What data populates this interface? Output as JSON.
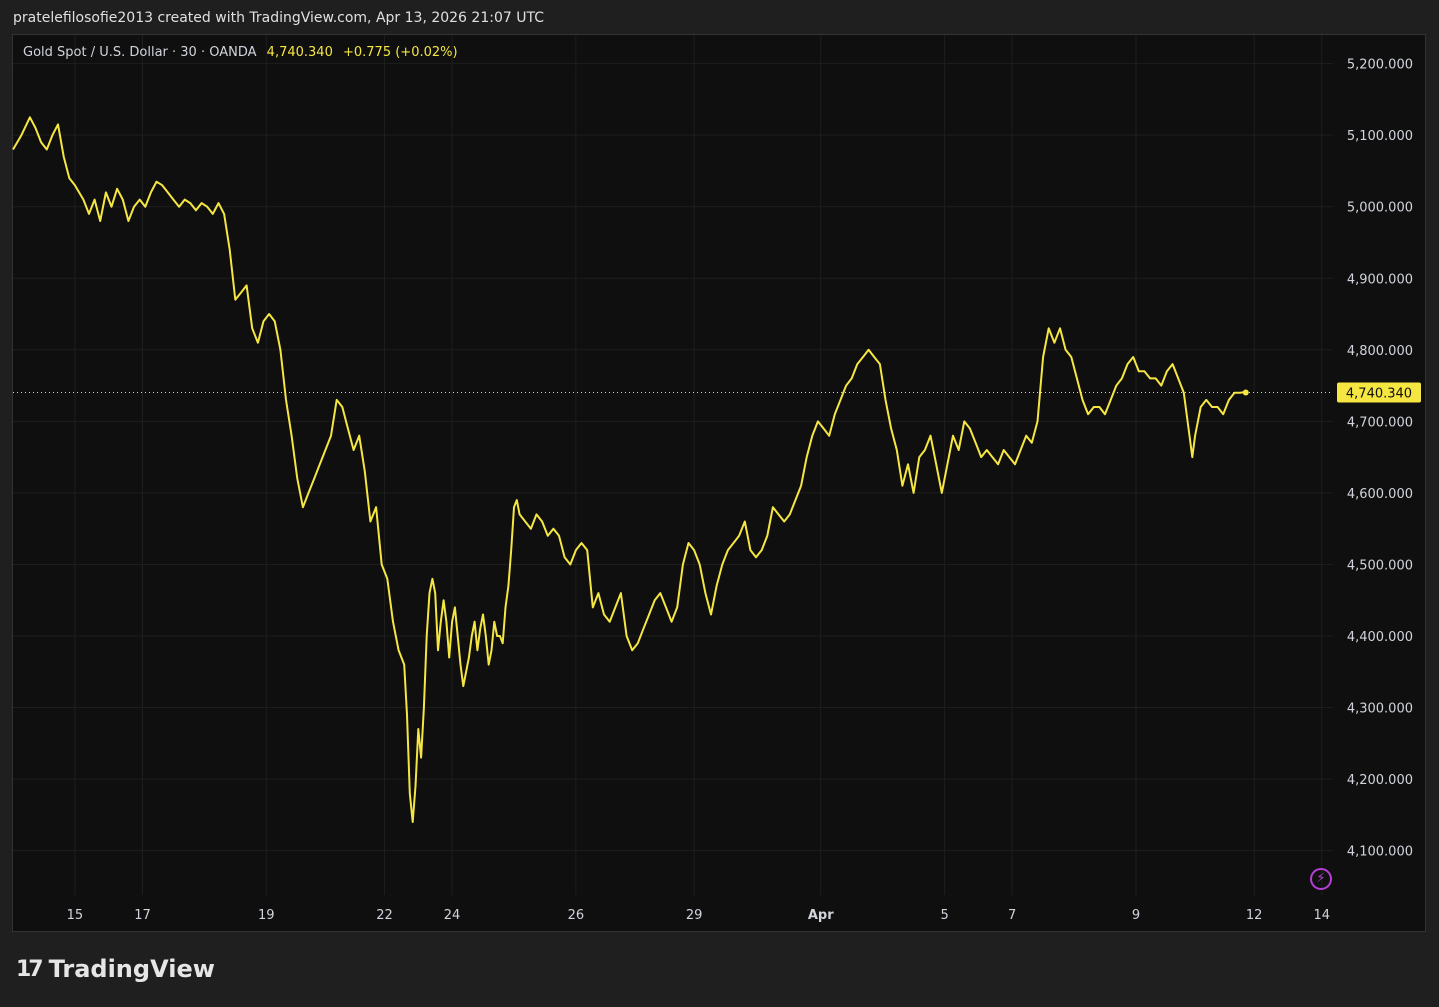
{
  "header": {
    "attribution": "pratelefilosofie2013 created with TradingView.com, Apr 13, 2026 21:07 UTC"
  },
  "legend": {
    "symbol": "Gold Spot / U.S. Dollar · 30 · OANDA",
    "last_price": "4,740.340",
    "change": "+0.775 (+0.02%)"
  },
  "brand": {
    "name": "TradingView",
    "mark": "17"
  },
  "colors": {
    "line": "#f5e642",
    "background": "#0f0f0f",
    "grid": "#1e1e1e",
    "alert_icon": "#b53fd6"
  },
  "icons": [
    "tradingview-logo-icon",
    "lightning-alert-icon"
  ],
  "chart_data": {
    "type": "line",
    "series": [
      {
        "values": [
          [
            0,
            5080
          ],
          [
            3,
            5100
          ],
          [
            6,
            5125
          ],
          [
            8,
            5110
          ],
          [
            10,
            5090
          ],
          [
            12,
            5080
          ],
          [
            14,
            5100
          ],
          [
            16,
            5115
          ],
          [
            18,
            5070
          ],
          [
            20,
            5040
          ],
          [
            22,
            5030
          ],
          [
            25,
            5010
          ],
          [
            27,
            4990
          ],
          [
            29,
            5010
          ],
          [
            31,
            4980
          ],
          [
            33,
            5020
          ],
          [
            35,
            5000
          ],
          [
            37,
            5025
          ],
          [
            39,
            5010
          ],
          [
            41,
            4980
          ],
          [
            43,
            5000
          ],
          [
            45,
            5010
          ],
          [
            47,
            5000
          ],
          [
            49,
            5020
          ],
          [
            51,
            5035
          ],
          [
            53,
            5030
          ],
          [
            55,
            5020
          ],
          [
            57,
            5010
          ],
          [
            59,
            5000
          ],
          [
            61,
            5010
          ],
          [
            63,
            5005
          ],
          [
            65,
            4995
          ],
          [
            67,
            5005
          ],
          [
            69,
            5000
          ],
          [
            71,
            4990
          ],
          [
            73,
            5005
          ],
          [
            75,
            4990
          ],
          [
            77,
            4940
          ],
          [
            79,
            4870
          ],
          [
            81,
            4880
          ],
          [
            83,
            4890
          ],
          [
            85,
            4830
          ],
          [
            87,
            4810
          ],
          [
            89,
            4840
          ],
          [
            91,
            4850
          ],
          [
            93,
            4840
          ],
          [
            95,
            4800
          ],
          [
            97,
            4730
          ],
          [
            99,
            4680
          ],
          [
            101,
            4620
          ],
          [
            103,
            4580
          ],
          [
            105,
            4600
          ],
          [
            107,
            4620
          ],
          [
            109,
            4640
          ],
          [
            111,
            4660
          ],
          [
            113,
            4680
          ],
          [
            115,
            4730
          ],
          [
            117,
            4720
          ],
          [
            119,
            4690
          ],
          [
            121,
            4660
          ],
          [
            123,
            4680
          ],
          [
            125,
            4630
          ],
          [
            127,
            4560
          ],
          [
            129,
            4580
          ],
          [
            131,
            4500
          ],
          [
            133,
            4480
          ],
          [
            135,
            4420
          ],
          [
            137,
            4380
          ],
          [
            139,
            4360
          ],
          [
            140,
            4290
          ],
          [
            141,
            4180
          ],
          [
            142,
            4140
          ],
          [
            143,
            4190
          ],
          [
            144,
            4270
          ],
          [
            145,
            4230
          ],
          [
            146,
            4300
          ],
          [
            147,
            4400
          ],
          [
            148,
            4460
          ],
          [
            149,
            4480
          ],
          [
            150,
            4460
          ],
          [
            151,
            4380
          ],
          [
            152,
            4420
          ],
          [
            153,
            4450
          ],
          [
            154,
            4420
          ],
          [
            155,
            4370
          ],
          [
            156,
            4420
          ],
          [
            157,
            4440
          ],
          [
            158,
            4400
          ],
          [
            159,
            4360
          ],
          [
            160,
            4330
          ],
          [
            161,
            4350
          ],
          [
            162,
            4370
          ],
          [
            163,
            4400
          ],
          [
            164,
            4420
          ],
          [
            165,
            4380
          ],
          [
            166,
            4410
          ],
          [
            167,
            4430
          ],
          [
            168,
            4400
          ],
          [
            169,
            4360
          ],
          [
            170,
            4380
          ],
          [
            171,
            4420
          ],
          [
            172,
            4400
          ],
          [
            173,
            4400
          ],
          [
            174,
            4390
          ],
          [
            175,
            4440
          ],
          [
            176,
            4470
          ],
          [
            177,
            4520
          ],
          [
            178,
            4580
          ],
          [
            179,
            4590
          ],
          [
            180,
            4570
          ],
          [
            182,
            4560
          ],
          [
            184,
            4550
          ],
          [
            186,
            4570
          ],
          [
            188,
            4560
          ],
          [
            190,
            4540
          ],
          [
            192,
            4550
          ],
          [
            194,
            4540
          ],
          [
            196,
            4510
          ],
          [
            198,
            4500
          ],
          [
            200,
            4520
          ],
          [
            202,
            4530
          ],
          [
            204,
            4520
          ],
          [
            206,
            4440
          ],
          [
            208,
            4460
          ],
          [
            210,
            4430
          ],
          [
            212,
            4420
          ],
          [
            214,
            4440
          ],
          [
            216,
            4460
          ],
          [
            218,
            4400
          ],
          [
            220,
            4380
          ],
          [
            222,
            4390
          ],
          [
            224,
            4410
          ],
          [
            226,
            4430
          ],
          [
            228,
            4450
          ],
          [
            230,
            4460
          ],
          [
            232,
            4440
          ],
          [
            234,
            4420
          ],
          [
            236,
            4440
          ],
          [
            238,
            4500
          ],
          [
            240,
            4530
          ],
          [
            242,
            4520
          ],
          [
            244,
            4500
          ],
          [
            246,
            4460
          ],
          [
            248,
            4430
          ],
          [
            250,
            4470
          ],
          [
            252,
            4500
          ],
          [
            254,
            4520
          ],
          [
            256,
            4530
          ],
          [
            258,
            4540
          ],
          [
            260,
            4560
          ],
          [
            262,
            4520
          ],
          [
            264,
            4510
          ],
          [
            266,
            4520
          ],
          [
            268,
            4540
          ],
          [
            270,
            4580
          ],
          [
            272,
            4570
          ],
          [
            274,
            4560
          ],
          [
            276,
            4570
          ],
          [
            278,
            4590
          ],
          [
            280,
            4610
          ],
          [
            282,
            4650
          ],
          [
            284,
            4680
          ],
          [
            286,
            4700
          ],
          [
            288,
            4690
          ],
          [
            290,
            4680
          ],
          [
            292,
            4710
          ],
          [
            294,
            4730
          ],
          [
            296,
            4750
          ],
          [
            298,
            4760
          ],
          [
            300,
            4780
          ],
          [
            302,
            4790
          ],
          [
            304,
            4800
          ],
          [
            306,
            4790
          ],
          [
            308,
            4780
          ],
          [
            310,
            4730
          ],
          [
            312,
            4690
          ],
          [
            314,
            4660
          ],
          [
            316,
            4610
          ],
          [
            318,
            4640
          ],
          [
            320,
            4600
          ],
          [
            322,
            4650
          ],
          [
            324,
            4660
          ],
          [
            326,
            4680
          ],
          [
            328,
            4640
          ],
          [
            330,
            4600
          ],
          [
            332,
            4640
          ],
          [
            334,
            4680
          ],
          [
            336,
            4660
          ],
          [
            338,
            4700
          ],
          [
            340,
            4690
          ],
          [
            342,
            4670
          ],
          [
            344,
            4650
          ],
          [
            346,
            4660
          ],
          [
            348,
            4650
          ],
          [
            350,
            4640
          ],
          [
            352,
            4660
          ],
          [
            354,
            4650
          ],
          [
            356,
            4640
          ],
          [
            358,
            4660
          ],
          [
            360,
            4680
          ],
          [
            362,
            4670
          ],
          [
            364,
            4700
          ],
          [
            366,
            4790
          ],
          [
            368,
            4830
          ],
          [
            370,
            4810
          ],
          [
            372,
            4830
          ],
          [
            374,
            4800
          ],
          [
            376,
            4790
          ],
          [
            378,
            4760
          ],
          [
            380,
            4730
          ],
          [
            382,
            4710
          ],
          [
            384,
            4720
          ],
          [
            386,
            4720
          ],
          [
            388,
            4710
          ],
          [
            390,
            4730
          ],
          [
            392,
            4750
          ],
          [
            394,
            4760
          ],
          [
            396,
            4780
          ],
          [
            398,
            4790
          ],
          [
            400,
            4770
          ],
          [
            402,
            4770
          ],
          [
            404,
            4760
          ],
          [
            406,
            4760
          ],
          [
            408,
            4750
          ],
          [
            410,
            4770
          ],
          [
            412,
            4780
          ],
          [
            414,
            4760
          ],
          [
            416,
            4740
          ],
          [
            418,
            4680
          ],
          [
            419,
            4650
          ],
          [
            420,
            4680
          ],
          [
            422,
            4720
          ],
          [
            424,
            4730
          ],
          [
            426,
            4720
          ],
          [
            428,
            4720
          ],
          [
            430,
            4710
          ],
          [
            432,
            4730
          ],
          [
            434,
            4740
          ],
          [
            436,
            4740
          ],
          [
            438,
            4741
          ]
        ]
      }
    ],
    "x_ticks": [
      {
        "label": "15",
        "at": 22
      },
      {
        "label": "17",
        "at": 46
      },
      {
        "label": "19",
        "at": 90
      },
      {
        "label": "22",
        "at": 132
      },
      {
        "label": "24",
        "at": 156
      },
      {
        "label": "26",
        "at": 200
      },
      {
        "label": "29",
        "at": 242
      },
      {
        "label": "Apr",
        "at": 287,
        "month": true
      },
      {
        "label": "5",
        "at": 331
      },
      {
        "label": "7",
        "at": 355
      },
      {
        "label": "9",
        "at": 399
      },
      {
        "label": "12",
        "at": 441
      },
      {
        "label": "14",
        "at": 465
      }
    ],
    "y_ticks": [
      {
        "label": "5,200.000",
        "value": 5200
      },
      {
        "label": "5,100.000",
        "value": 5100
      },
      {
        "label": "5,000.000",
        "value": 5000
      },
      {
        "label": "4,900.000",
        "value": 4900
      },
      {
        "label": "4,800.000",
        "value": 4800
      },
      {
        "label": "4,700.000",
        "value": 4700
      },
      {
        "label": "4,600.000",
        "value": 4600
      },
      {
        "label": "4,500.000",
        "value": 4500
      },
      {
        "label": "4,400.000",
        "value": 4400
      },
      {
        "label": "4,300.000",
        "value": 4300
      },
      {
        "label": "4,200.000",
        "value": 4200
      },
      {
        "label": "4,100.000",
        "value": 4100
      }
    ],
    "last_value": 4740.34,
    "last_value_label": "4,740.340",
    "xlim": [
      0,
      469
    ],
    "ylim": [
      4038,
      5240
    ],
    "grid": true,
    "legend_placement": "top-left"
  }
}
